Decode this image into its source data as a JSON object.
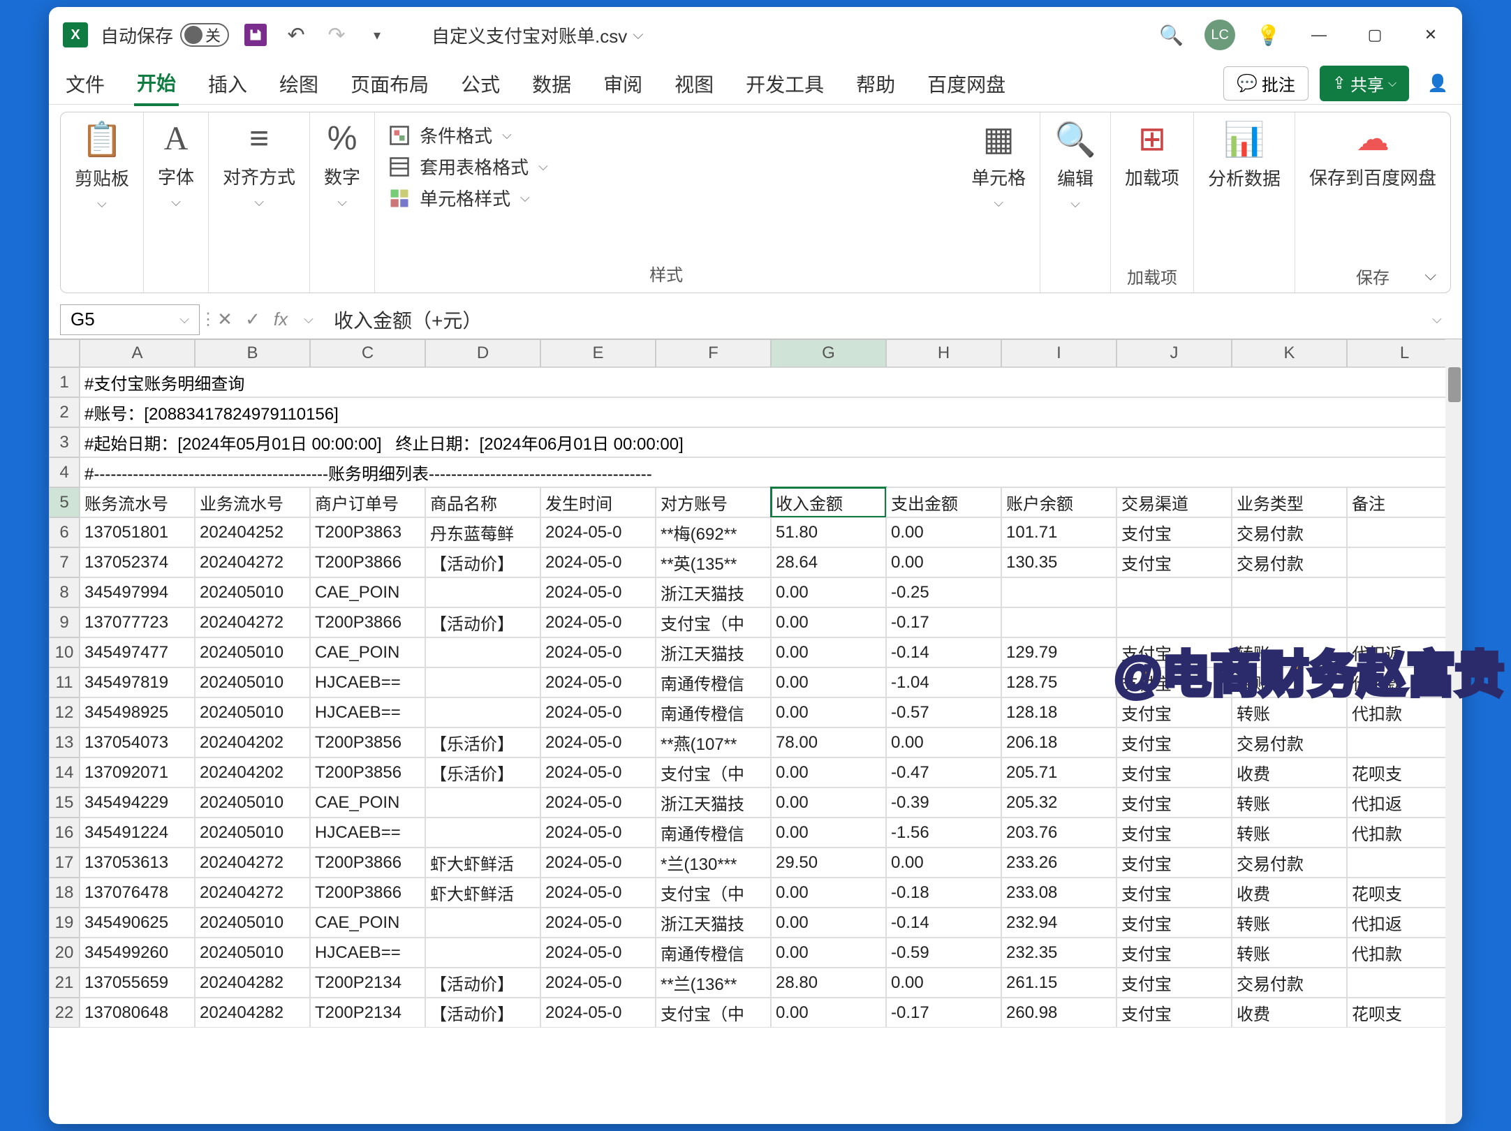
{
  "title": {
    "autosave": "自动保存",
    "autosave_state": "关",
    "filename": "自定义支付宝对账单.csv",
    "avatar": "LC"
  },
  "tabs": {
    "file": "文件",
    "home": "开始",
    "insert": "插入",
    "draw": "绘图",
    "layout": "页面布局",
    "formula": "公式",
    "data": "数据",
    "review": "审阅",
    "view": "视图",
    "dev": "开发工具",
    "help": "帮助",
    "baidu": "百度网盘",
    "comment": "批注",
    "share": "共享"
  },
  "ribbon": {
    "clipboard": "剪贴板",
    "font": "字体",
    "align": "对齐方式",
    "number": "数字",
    "condfmt": "条件格式",
    "tablefmt": "套用表格格式",
    "cellstyle": "单元格样式",
    "styles": "样式",
    "cells": "单元格",
    "editing": "编辑",
    "addins": "加载项",
    "addins_footer": "加载项",
    "analyze": "分析数据",
    "savebaidu": "保存到百度网盘",
    "save_footer": "保存"
  },
  "fbar": {
    "namebox": "G5",
    "formula": "收入金额（+元）"
  },
  "cols": [
    "A",
    "B",
    "C",
    "D",
    "E",
    "F",
    "G",
    "H",
    "I",
    "J",
    "K",
    "L"
  ],
  "meta_rows": [
    "#支付宝账务明细查询",
    "#账号：[20883417824979110156]",
    "#起始日期：[2024年05月01日 00:00:00]   终止日期：[2024年06月01日 00:00:00]",
    "#------------------------------------------账务明细列表----------------------------------------"
  ],
  "headers": [
    "账务流水号",
    "业务流水号",
    "商户订单号",
    "商品名称",
    "发生时间",
    "对方账号",
    "收入金额",
    "支出金额",
    "账户余额",
    "交易渠道",
    "业务类型",
    "备注"
  ],
  "rows": [
    [
      "137051801",
      "202404252",
      "T200P3863",
      "丹东蓝莓鲜",
      "2024-05-0",
      "**梅(692**",
      "51.80",
      "0.00",
      "101.71",
      "支付宝",
      "交易付款",
      ""
    ],
    [
      "137052374",
      "202404272",
      "T200P3866",
      "【活动价】",
      "2024-05-0",
      "**英(135**",
      "28.64",
      "0.00",
      "130.35",
      "支付宝",
      "交易付款",
      ""
    ],
    [
      "345497994",
      "202405010",
      "CAE_POIN",
      "",
      "2024-05-0",
      "浙江天猫技",
      "0.00",
      "-0.25",
      "",
      "",
      "",
      ""
    ],
    [
      "137077723",
      "202404272",
      "T200P3866",
      "【活动价】",
      "2024-05-0",
      "支付宝（中",
      "0.00",
      "-0.17",
      "",
      "",
      "",
      ""
    ],
    [
      "345497477",
      "202405010",
      "CAE_POIN",
      "",
      "2024-05-0",
      "浙江天猫技",
      "0.00",
      "-0.14",
      "129.79",
      "支付宝",
      "转账",
      "代扣返"
    ],
    [
      "345497819",
      "202405010",
      "HJCAEB==",
      "",
      "2024-05-0",
      "南通传橙信",
      "0.00",
      "-1.04",
      "128.75",
      "支付宝",
      "转账",
      "代扣款"
    ],
    [
      "345498925",
      "202405010",
      "HJCAEB==",
      "",
      "2024-05-0",
      "南通传橙信",
      "0.00",
      "-0.57",
      "128.18",
      "支付宝",
      "转账",
      "代扣款"
    ],
    [
      "137054073",
      "202404202",
      "T200P3856",
      "【乐活价】",
      "2024-05-0",
      "**燕(107**",
      "78.00",
      "0.00",
      "206.18",
      "支付宝",
      "交易付款",
      ""
    ],
    [
      "137092071",
      "202404202",
      "T200P3856",
      "【乐活价】",
      "2024-05-0",
      "支付宝（中",
      "0.00",
      "-0.47",
      "205.71",
      "支付宝",
      "收费",
      "花呗支"
    ],
    [
      "345494229",
      "202405010",
      "CAE_POIN",
      "",
      "2024-05-0",
      "浙江天猫技",
      "0.00",
      "-0.39",
      "205.32",
      "支付宝",
      "转账",
      "代扣返"
    ],
    [
      "345491224",
      "202405010",
      "HJCAEB==",
      "",
      "2024-05-0",
      "南通传橙信",
      "0.00",
      "-1.56",
      "203.76",
      "支付宝",
      "转账",
      "代扣款"
    ],
    [
      "137053613",
      "202404272",
      "T200P3866",
      "虾大虾鲜活",
      "2024-05-0",
      "*兰(130***",
      "29.50",
      "0.00",
      "233.26",
      "支付宝",
      "交易付款",
      ""
    ],
    [
      "137076478",
      "202404272",
      "T200P3866",
      "虾大虾鲜活",
      "2024-05-0",
      "支付宝（中",
      "0.00",
      "-0.18",
      "233.08",
      "支付宝",
      "收费",
      "花呗支"
    ],
    [
      "345490625",
      "202405010",
      "CAE_POIN",
      "",
      "2024-05-0",
      "浙江天猫技",
      "0.00",
      "-0.14",
      "232.94",
      "支付宝",
      "转账",
      "代扣返"
    ],
    [
      "345499260",
      "202405010",
      "HJCAEB==",
      "",
      "2024-05-0",
      "南通传橙信",
      "0.00",
      "-0.59",
      "232.35",
      "支付宝",
      "转账",
      "代扣款"
    ],
    [
      "137055659",
      "202404282",
      "T200P2134",
      "【活动价】",
      "2024-05-0",
      "**兰(136**",
      "28.80",
      "0.00",
      "261.15",
      "支付宝",
      "交易付款",
      ""
    ],
    [
      "137080648",
      "202404282",
      "T200P2134",
      "【活动价】",
      "2024-05-0",
      "支付宝（中",
      "0.00",
      "-0.17",
      "260.98",
      "支付宝",
      "收费",
      "花呗支"
    ]
  ],
  "watermark": "@电商财务赵富贵"
}
